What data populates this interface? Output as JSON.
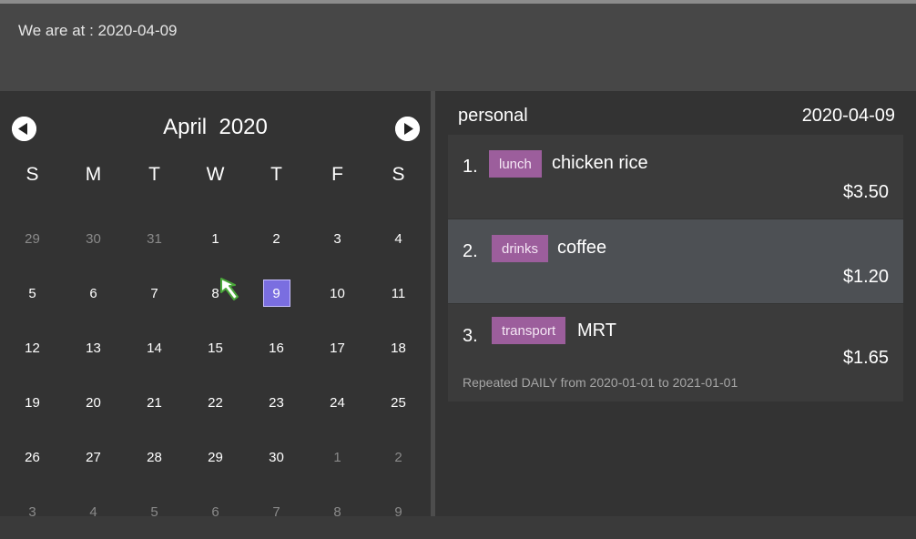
{
  "header": {
    "status_text": "We are at : 2020-04-09"
  },
  "calendar": {
    "month": "April",
    "year": "2020",
    "weekdays": [
      "S",
      "M",
      "T",
      "W",
      "T",
      "F",
      "S"
    ],
    "selected_day": "9",
    "weeks": [
      [
        [
          "29",
          1
        ],
        [
          "30",
          1
        ],
        [
          "31",
          1
        ],
        [
          "1",
          0
        ],
        [
          "2",
          0
        ],
        [
          "3",
          0
        ],
        [
          "4",
          0
        ]
      ],
      [
        [
          "5",
          0
        ],
        [
          "6",
          0
        ],
        [
          "7",
          0
        ],
        [
          "8",
          0
        ],
        [
          "9",
          0
        ],
        [
          "10",
          0
        ],
        [
          "11",
          0
        ]
      ],
      [
        [
          "12",
          0
        ],
        [
          "13",
          0
        ],
        [
          "14",
          0
        ],
        [
          "15",
          0
        ],
        [
          "16",
          0
        ],
        [
          "17",
          0
        ],
        [
          "18",
          0
        ]
      ],
      [
        [
          "19",
          0
        ],
        [
          "20",
          0
        ],
        [
          "21",
          0
        ],
        [
          "22",
          0
        ],
        [
          "23",
          0
        ],
        [
          "24",
          0
        ],
        [
          "25",
          0
        ]
      ],
      [
        [
          "26",
          0
        ],
        [
          "27",
          0
        ],
        [
          "28",
          0
        ],
        [
          "29",
          0
        ],
        [
          "30",
          0
        ],
        [
          "1",
          1
        ],
        [
          "2",
          1
        ]
      ],
      [
        [
          "3",
          1
        ],
        [
          "4",
          1
        ],
        [
          "5",
          1
        ],
        [
          "6",
          1
        ],
        [
          "7",
          1
        ],
        [
          "8",
          1
        ],
        [
          "9",
          1
        ]
      ]
    ],
    "prev_icon": "arrow-left-icon",
    "next_icon": "arrow-right-icon",
    "selected_color": "#7a6ee0"
  },
  "expenses": {
    "list_name": "personal",
    "date": "2020-04-09",
    "tag_color": "#9c5e9c",
    "items": [
      {
        "index": "1.",
        "tag": "lunch",
        "name": "chicken rice",
        "amount": "$3.50",
        "repeat": ""
      },
      {
        "index": "2.",
        "tag": "drinks",
        "name": "coffee",
        "amount": "$1.20",
        "repeat": ""
      },
      {
        "index": "3.",
        "tag": "transport",
        "name": "MRT",
        "amount": "$1.65",
        "repeat": "Repeated DAILY from 2020-01-01 to 2021-01-01"
      }
    ]
  }
}
